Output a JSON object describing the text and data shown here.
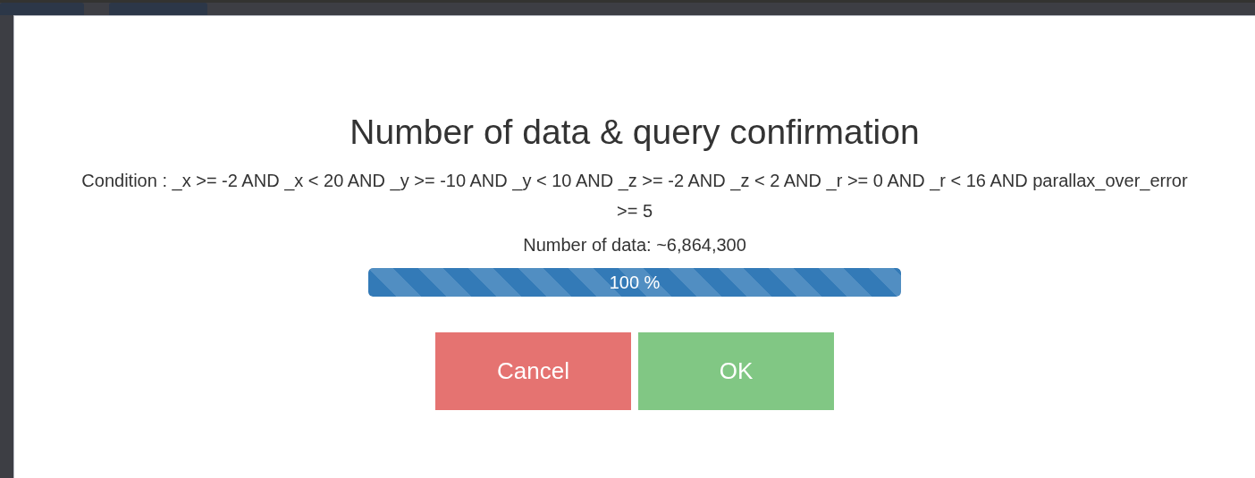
{
  "dialog": {
    "title": "Number of data & query confirmation",
    "condition": "Condition : _x >= -2 AND _x < 20 AND _y >= -10 AND _y < 10 AND _z >= -2 AND _z < 2 AND _r >= 0 AND _r < 16 AND parallax_over_error >= 5",
    "count": "Number of data: ~6,864,300",
    "progress": {
      "level": 1,
      "label": "100 %"
    },
    "buttons": [
      {
        "label": "Cancel",
        "kind": "cancel"
      },
      {
        "label": "OK",
        "kind": "ok"
      }
    ]
  }
}
